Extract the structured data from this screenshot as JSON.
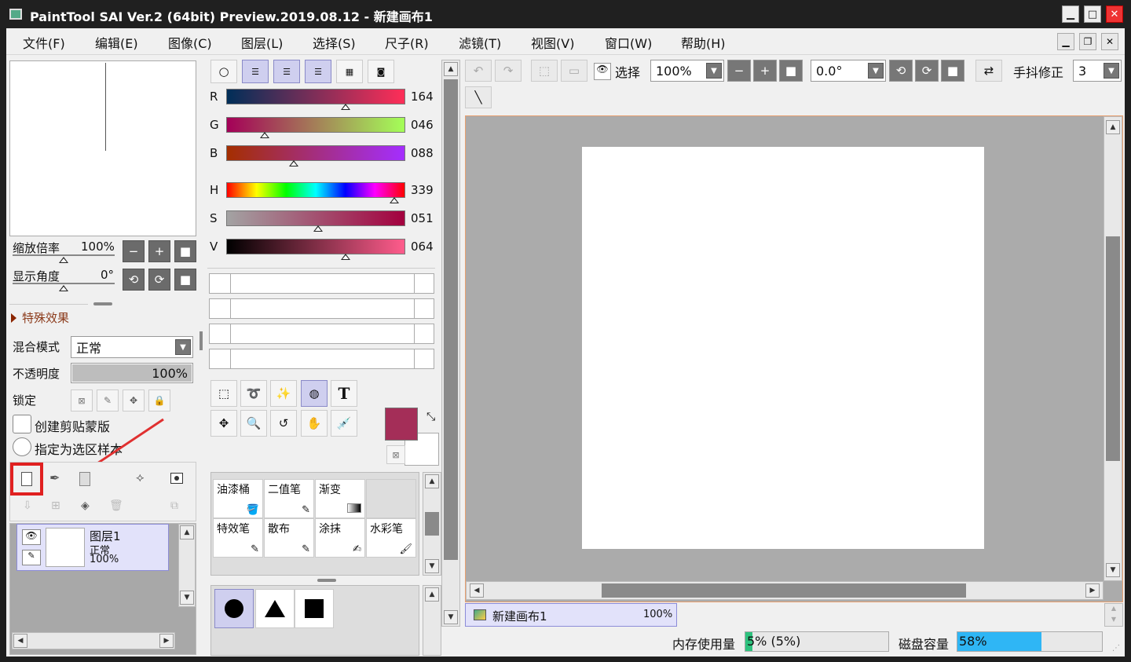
{
  "titlebar": {
    "title": "PaintTool SAI Ver.2 (64bit) Preview.2019.08.12 - 新建画布1"
  },
  "menu": [
    "文件(F)",
    "编辑(E)",
    "图像(C)",
    "图层(L)",
    "选择(S)",
    "尺子(R)",
    "滤镜(T)",
    "视图(V)",
    "窗口(W)",
    "帮助(H)"
  ],
  "navigator": {
    "zoom_label": "缩放倍率",
    "zoom_value": "100%",
    "angle_label": "显示角度",
    "angle_value": "0°"
  },
  "layer_props": {
    "effects_label": "特殊效果",
    "blend_label": "混合模式",
    "blend_value": "正常",
    "opacity_label": "不透明度",
    "opacity_value": "100%",
    "lock_label": "锁定",
    "clip_label": "创建剪贴蒙版",
    "sample_label": "指定为选区样本"
  },
  "layers": [
    {
      "name": "图层1",
      "mode": "正常",
      "opacity": "100%"
    }
  ],
  "color": {
    "rgb": [
      {
        "label": "R",
        "value": "164"
      },
      {
        "label": "G",
        "value": "046"
      },
      {
        "label": "B",
        "value": "088"
      }
    ],
    "hsv": [
      {
        "label": "H",
        "value": "339"
      },
      {
        "label": "S",
        "value": "051"
      },
      {
        "label": "V",
        "value": "064"
      }
    ],
    "primary": "#a42e58"
  },
  "brushes": [
    {
      "name": "油漆桶"
    },
    {
      "name": "二值笔"
    },
    {
      "name": "渐变"
    },
    {
      "name": ""
    },
    {
      "name": "特效笔"
    },
    {
      "name": "散布"
    },
    {
      "name": "涂抹"
    },
    {
      "name": "水彩笔"
    }
  ],
  "toolbar": {
    "select_label": "选择",
    "zoom_value": "100%",
    "angle_value": "0.0°",
    "stabilizer_label": "手抖修正",
    "stabilizer_value": "3"
  },
  "doc_tab": {
    "name": "新建画布1",
    "zoom": "100%"
  },
  "status": {
    "mem_label": "内存使用量",
    "mem_value": "5% (5%)",
    "mem_fraction": 0.05,
    "disk_label": "磁盘容量",
    "disk_value": "58%",
    "disk_fraction": 0.58
  }
}
